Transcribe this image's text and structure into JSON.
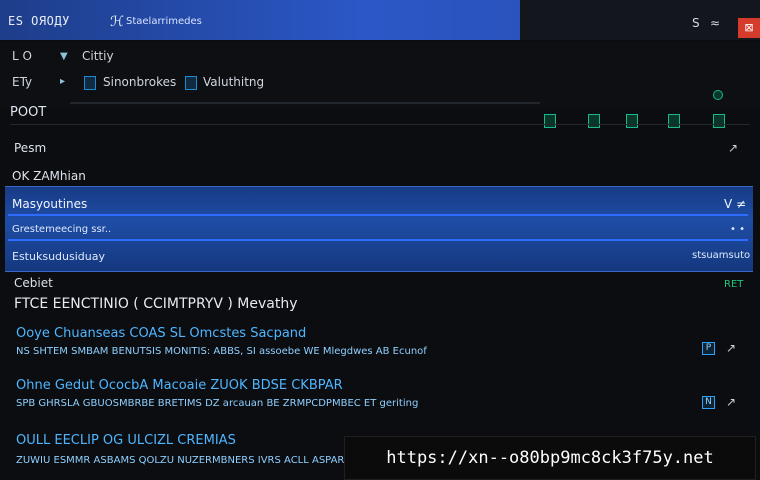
{
  "window": {
    "title": "ES ОЯОДУ",
    "subtitle": "Staelarrimedes",
    "controls": [
      "S",
      "≈",
      "⊠"
    ],
    "title_mark": "ℋ"
  },
  "nav": {
    "left_labels": [
      "L O",
      "ETy"
    ],
    "menu_label": "Cittiy",
    "items": [
      {
        "label": "Sinonbrokes",
        "icon": "square-icon"
      },
      {
        "label": "Valuthitng",
        "icon": "square-icon"
      }
    ]
  },
  "root": {
    "label": "POOT"
  },
  "panels": {
    "top_items": [
      {
        "label": "Pesm",
        "action": "↗"
      },
      {
        "label": "OK ZAMhian",
        "action": ""
      }
    ],
    "selected": {
      "label": "Masyoutines",
      "right": "V ≠",
      "lines": [
        {
          "label": "Grestemeecing  ssr..",
          "right": "• •"
        },
        {
          "label": "Estuksudusiduay",
          "right": "stsuamsuto"
        }
      ]
    }
  },
  "section": {
    "label": "Cebiet",
    "right": "RET",
    "heading": "FTCE EENCTINIO ( CCIMTPRYV ) Mevathy"
  },
  "rows": [
    {
      "title": "Ooye  Chuanseas  COAS  SL  Omcstes  Sacpand",
      "detail": "NS SHTEM SMBAM  BENUTSIS MONITIS: ABBS, SI  assoebe WE Mlegdwes AB Ecunof",
      "icon": "P",
      "action": "↗"
    },
    {
      "title": "Ohne  Gedut  OcocbA Macoaie  ZUOK  BDSE  CKBPAR",
      "detail": "SPB GHRSLA  GBUOSMBRBE  BRETIMS  DZ  arcauan  BE ZRMPCDPMBEC ET  geriting",
      "icon": "N",
      "action": "↗"
    },
    {
      "title": "OULL  EECLIP  OG  ULCIZL  CREMIAS",
      "detail": "ZUWIU ESMMR ASBAMS  QOLZU  NUZERMBNERS IVRS  ACLL  ASPARERMS",
      "icon": "",
      "action": ""
    }
  ],
  "watermark": {
    "text": "https://xn--o80bp9mc8ck3f75y.net"
  },
  "colors": {
    "title_blue": "#2b58c7",
    "selected_band": "#1f4da6",
    "accent_blue": "#4fb6ff",
    "accent_green": "#22c47c",
    "close_red": "#d53b2a"
  },
  "icons": {
    "toolbar": [
      "network-icon",
      "pin-icon",
      "folder-icon",
      "document-icon",
      "tile-icon",
      "circle-icon"
    ]
  }
}
